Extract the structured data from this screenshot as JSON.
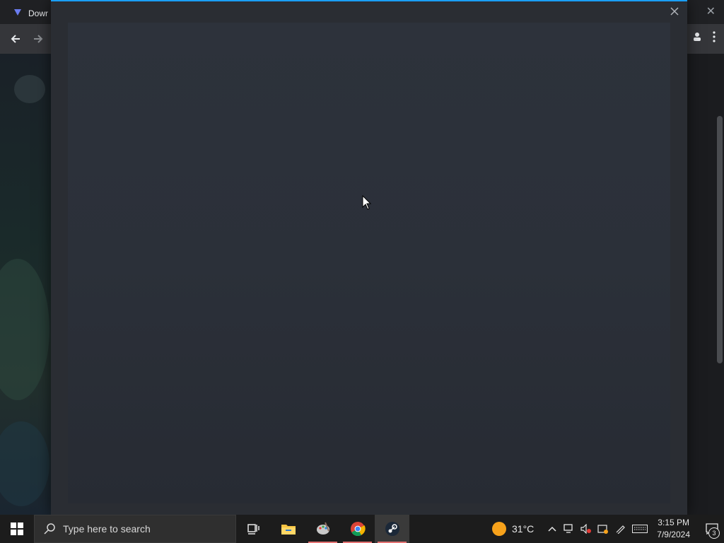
{
  "browser": {
    "tab_title": "Dowr",
    "tab_icon": "steam-deck-icon"
  },
  "modal": {
    "accent_color": "#1a9fff",
    "close_icon": "close-icon"
  },
  "taskbar": {
    "search_placeholder": "Type here to search",
    "apps": [
      {
        "name": "task-view"
      },
      {
        "name": "file-explorer"
      },
      {
        "name": "paint-app"
      },
      {
        "name": "chrome"
      },
      {
        "name": "steam"
      }
    ],
    "weather": {
      "temperature": "31°C"
    },
    "clock": {
      "time": "3:15 PM",
      "date": "7/9/2024"
    },
    "notifications": {
      "count": "3"
    }
  }
}
